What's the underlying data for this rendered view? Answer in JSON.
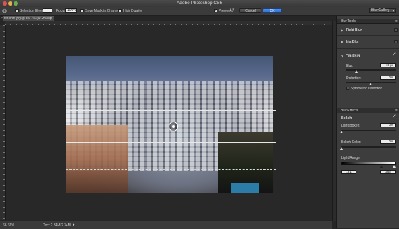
{
  "app": {
    "title": "Adobe Photoshop CS6"
  },
  "options_bar": {
    "selection_bleed_label": "Selection Bleed:",
    "focus_label": "Focus:",
    "focus_value": "100%",
    "save_mask_label": "Save Mask to Channels",
    "high_quality_label": "High Quality",
    "preview_label": "Preview",
    "cancel_label": "Cancel",
    "ok_label": "OK",
    "workspace_value": "Blur Gallery"
  },
  "document": {
    "tab_label": "tilt-shift.jpg @ 66.7% (RGB/8#)"
  },
  "status_bar": {
    "zoom": "66.67%",
    "doc_info": "Doc: 2.34M/2.34M"
  },
  "blur_tools": {
    "header": "Blur Tools",
    "field_blur": "Field Blur",
    "iris_blur": "Iris Blur",
    "tilt_shift": "Tilt-Shift",
    "blur_label": "Blur:",
    "blur_value": "15 px",
    "blur_level": 0.22,
    "distortion_label": "Distortion:",
    "distortion_value": "0%",
    "distortion_level": 0.5,
    "symmetric_label": "Symmetric Distortion"
  },
  "blur_effects": {
    "header": "Blur Effects",
    "bokeh_label": "Bokeh",
    "light_bokeh_label": "Light Bokeh:",
    "light_bokeh_value": "0%",
    "light_bokeh_level": 0.0,
    "bokeh_color_label": "Bokeh Color:",
    "bokeh_color_value": "0%",
    "bokeh_color_level": 0.0,
    "light_range_label": "Light Range:",
    "light_range_min": "191",
    "light_range_max": "255"
  }
}
